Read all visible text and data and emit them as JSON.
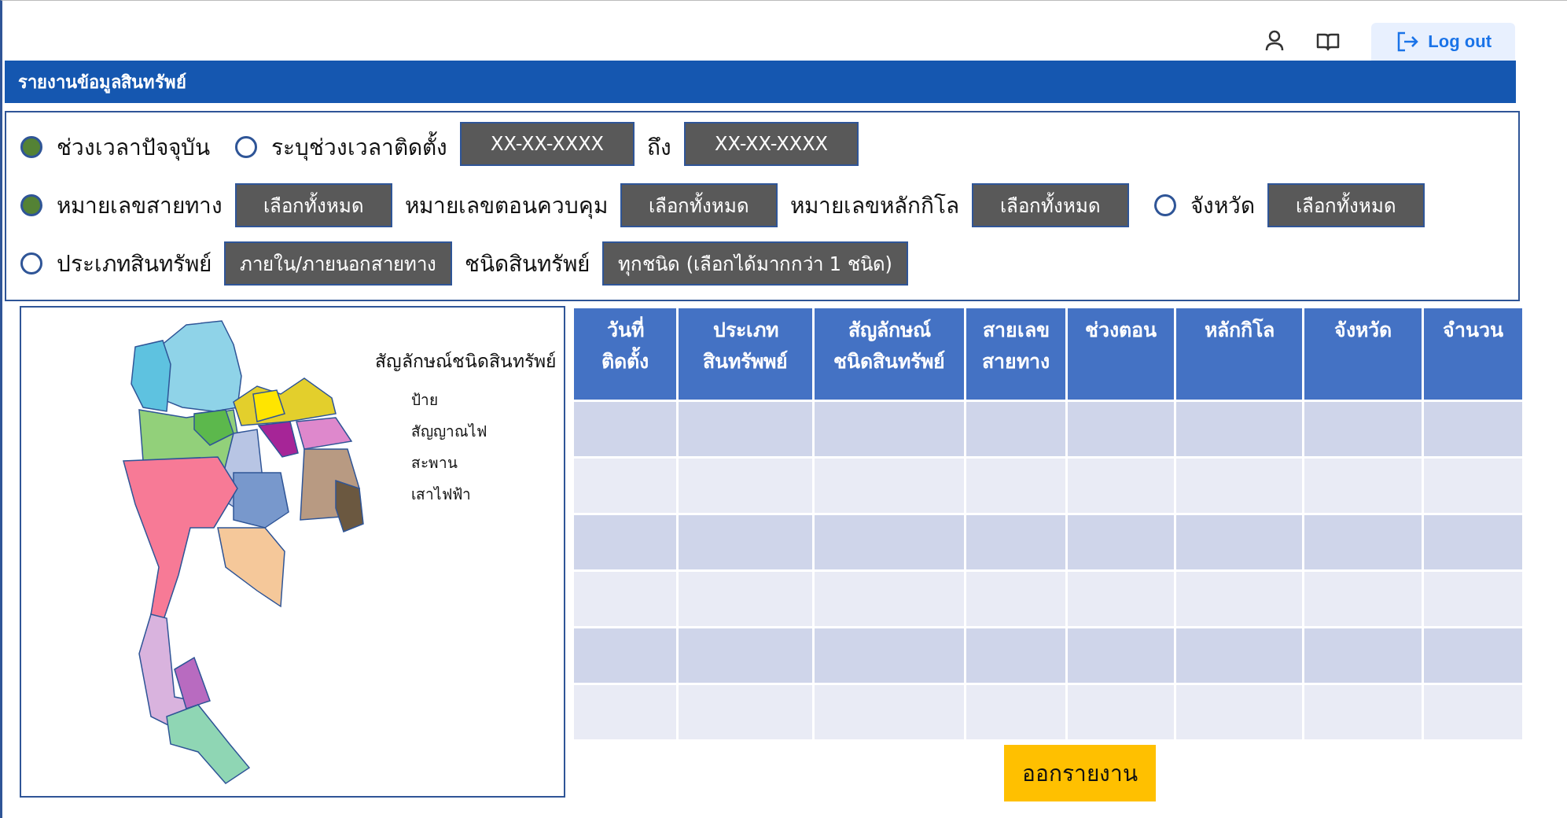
{
  "top_bar": {
    "logout_button": "Log out"
  },
  "title_bar": {
    "title": "รายงานข้อมูลสินทรัพย์"
  },
  "filters": [
    [
      {
        "kind": "radio",
        "label": "ช่วงเวลาปัจจุบัน",
        "selected": true
      },
      {
        "kind": "radio",
        "label": "ระบุช่วงเวลาติดตั้ง",
        "selected": false
      },
      {
        "kind": "date",
        "value": "XX-XX-XXXX"
      },
      {
        "kind": "label",
        "text": "ถึง"
      },
      {
        "kind": "date",
        "value": "XX-XX-XXXX"
      }
    ],
    [
      {
        "kind": "radio",
        "label": "หมายเลขสายทาง",
        "selected": true
      },
      {
        "kind": "select",
        "value": "เลือกทั้งหมด"
      },
      {
        "kind": "label",
        "text": "หมายเลขตอนควบคุม"
      },
      {
        "kind": "select",
        "value": "เลือกทั้งหมด"
      },
      {
        "kind": "label",
        "text": "หมายเลขหลักกิโล"
      },
      {
        "kind": "select",
        "value": "เลือกทั้งหมด"
      },
      {
        "kind": "radio",
        "label": "จังหวัด",
        "selected": false
      },
      {
        "kind": "select",
        "value": "เลือกทั้งหมด"
      }
    ],
    [
      {
        "kind": "radio",
        "label": "ประเภทสินทรัพย์",
        "selected": false
      },
      {
        "kind": "select",
        "value": "ภายใน/ภายนอกสายทาง"
      },
      {
        "kind": "label",
        "text": "ชนิดสินทรัพย์"
      },
      {
        "kind": "select",
        "value": "ทุกชนิด (เลือกได้มากกว่า 1 ชนิด)"
      }
    ]
  ],
  "map_panel": {
    "map": {
      "kind": "picture"
    },
    "legend_title": "สัญลักษณ์ชนิดสินทรัพย์",
    "legend_items": [
      "ป้าย",
      "สัญญาณไฟ",
      "สะพาน",
      "เสาไฟฟ้า"
    ]
  },
  "table": {
    "columns": [
      "วันที่\nติดตั้ง",
      "ประเภท\nสินทรัพพย์",
      "สัญลักษณ์\nชนิดสินทรัพย์",
      "สายเลข\nสายทาง",
      "ช่วงตอน",
      "หลักกิโล",
      "จังหวัด",
      "จำนวน"
    ]
  },
  "export_button": "ออกรายงาน"
}
